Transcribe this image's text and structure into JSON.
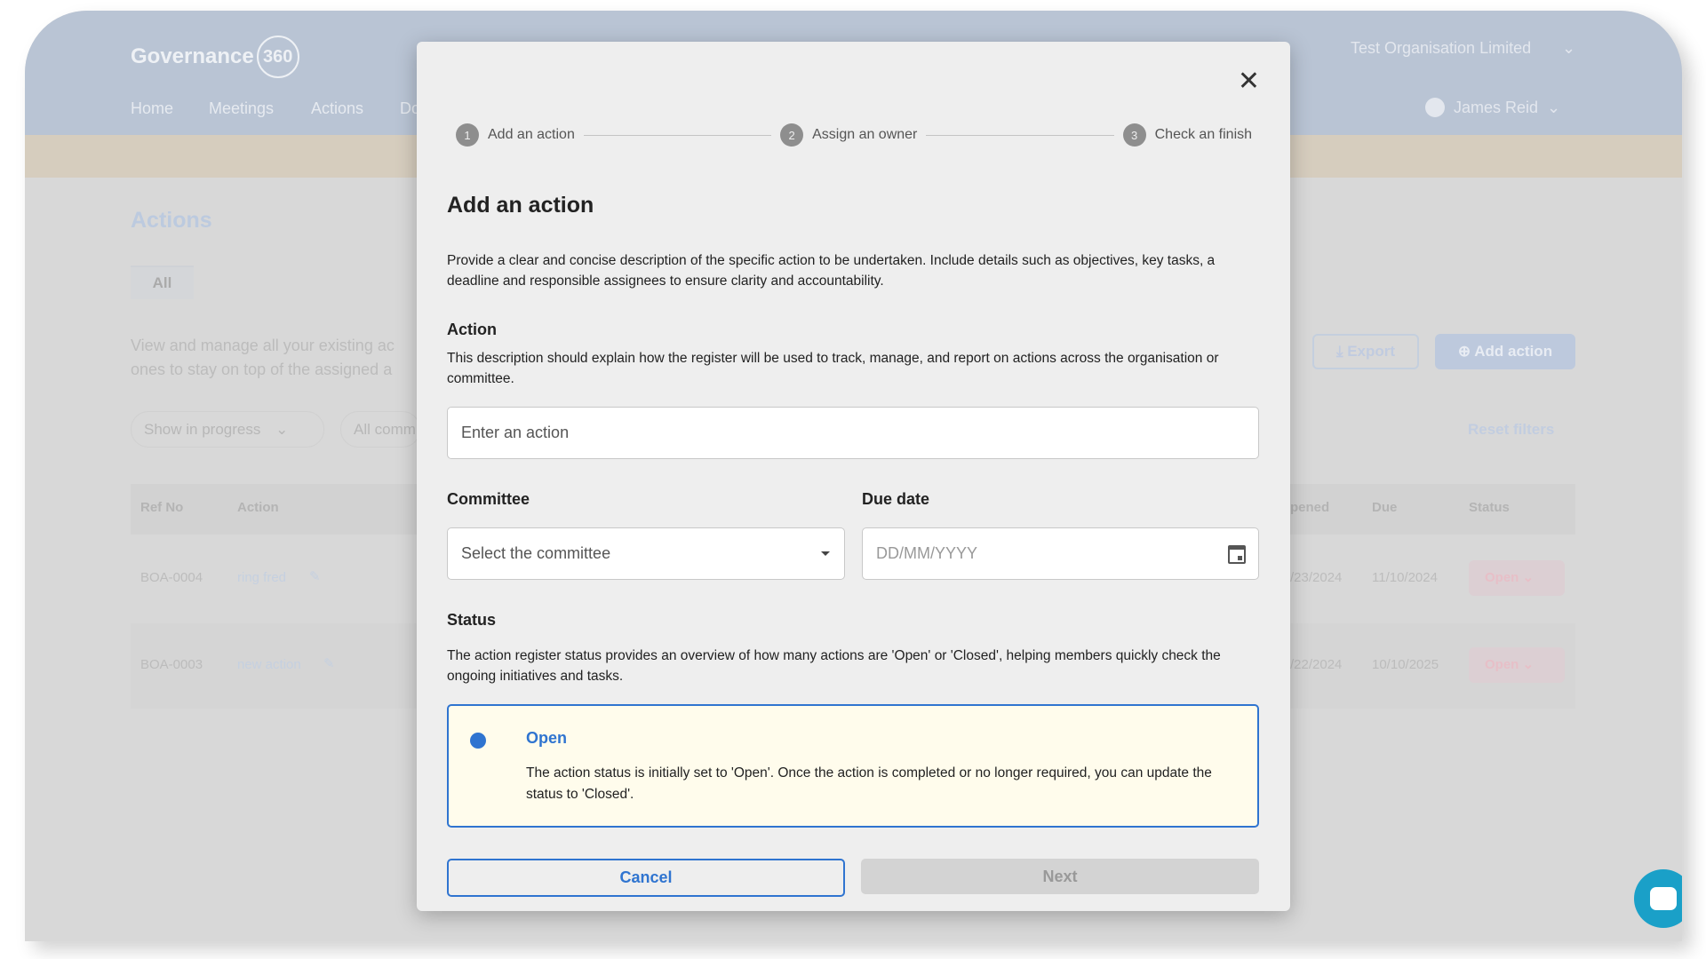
{
  "app": {
    "logo_text": "Governance",
    "logo_badge": "360",
    "nav": [
      "Home",
      "Meetings",
      "Actions",
      "Do"
    ],
    "organisation": "Test Organisation Limited",
    "user": "James Reid"
  },
  "page": {
    "title": "Actions",
    "tab": "All",
    "description_line1": "View and manage all your existing ac",
    "description_line2": "ones to stay on top of the assigned a",
    "filter1": "Show in progress",
    "filter2": "All comm",
    "export": "Export",
    "add_action": "Add action",
    "reset_filters": "Reset filters",
    "columns": {
      "ref": "Ref No",
      "action": "Action",
      "opened": "pened",
      "due": "Due",
      "status": "Status"
    },
    "rows": [
      {
        "ref": "BOA-0004",
        "action": "ring fred",
        "opened": "/23/2024",
        "due": "11/10/2024",
        "status": "Open"
      },
      {
        "ref": "BOA-0003",
        "action": "new action",
        "opened": "/22/2024",
        "due": "10/10/2025",
        "status": "Open"
      }
    ]
  },
  "modal": {
    "steps": [
      {
        "n": "1",
        "label": "Add an action"
      },
      {
        "n": "2",
        "label": "Assign an owner"
      },
      {
        "n": "3",
        "label": "Check an finish"
      }
    ],
    "title": "Add an action",
    "intro": "Provide a clear and concise description of the specific action to be undertaken. Include details such as objectives, key tasks, a deadline and responsible assignees to ensure clarity and accountability.",
    "action_label": "Action",
    "action_help": "This description should explain how the register will be used to track, manage, and report on actions across the organisation or committee.",
    "action_placeholder": "Enter an action",
    "committee_label": "Committee",
    "committee_placeholder": "Select the committee",
    "due_label": "Due date",
    "due_placeholder": "DD/MM/YYYY",
    "status_label": "Status",
    "status_help": "The action register status provides an overview of how many actions are 'Open' or 'Closed', helping members quickly check the ongoing initiatives and tasks.",
    "status_option": "Open",
    "status_option_desc": "The action status is initially set to 'Open'. Once the action is completed or no longer required, you can update the status to 'Closed'.",
    "cancel": "Cancel",
    "next": "Next"
  },
  "colors": {
    "accent": "#2f74d0",
    "option_bg": "#fffcec",
    "chat": "#1aa0c8"
  }
}
